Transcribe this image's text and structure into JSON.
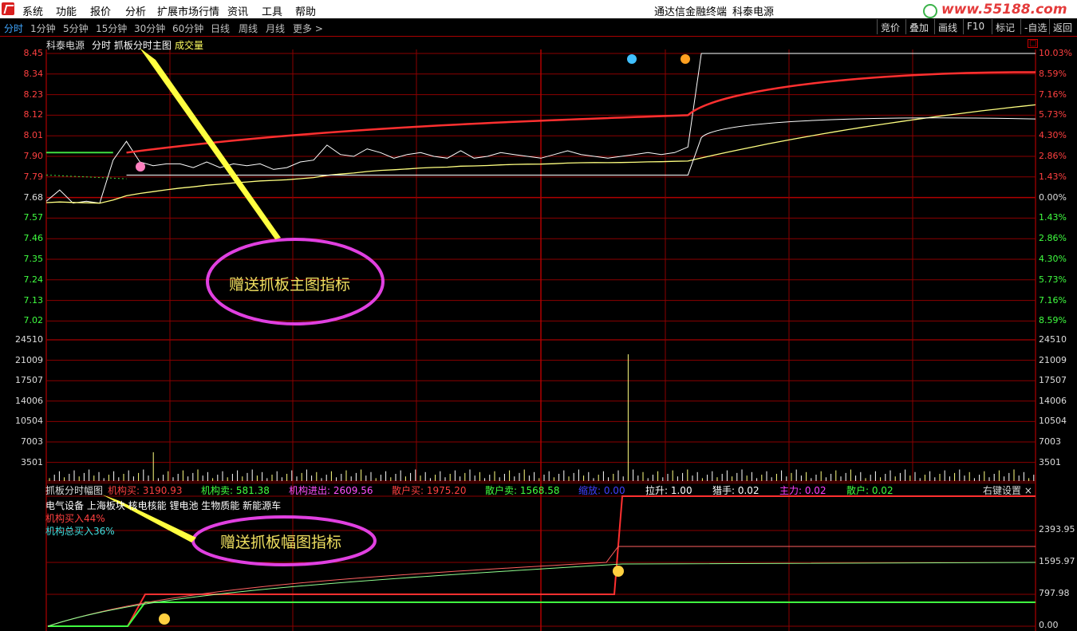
{
  "menu": {
    "items": [
      "系统",
      "功能",
      "报价",
      "分析",
      "扩展市场行情",
      "资讯",
      "工具",
      "帮助"
    ],
    "title": "通达信金融终端",
    "stock_name": "科泰电源",
    "watermark": "www.55188.com"
  },
  "periods": [
    "分时",
    "1分钟",
    "5分钟",
    "15分钟",
    "30分钟",
    "60分钟",
    "日线",
    "周线",
    "月线",
    "更多 >"
  ],
  "right_buttons": [
    "竞价",
    "叠加",
    "画线",
    "F10",
    "标记",
    "-自选",
    "返回"
  ],
  "main_legend": {
    "stock": "科泰电源",
    "label": "分时 抓板分时主图",
    "volume": "成交量"
  },
  "annotations": {
    "main": "赠送抓板主图指标",
    "sub": "赠送抓板幅图指标"
  },
  "price_axis": [
    "8.45",
    "8.34",
    "8.23",
    "8.12",
    "8.01",
    "7.90",
    "7.79",
    "7.68",
    "7.57",
    "7.46",
    "7.35",
    "7.24",
    "7.13",
    "7.02"
  ],
  "pct_axis": [
    "10.03%",
    "8.59%",
    "7.16%",
    "5.73%",
    "4.30%",
    "2.86%",
    "1.43%",
    "0.00%",
    "1.43%",
    "2.86%",
    "4.30%",
    "5.73%",
    "7.16%",
    "8.59%"
  ],
  "vol_axis": [
    "24510",
    "21009",
    "17507",
    "14006",
    "10504",
    "7003",
    "3501"
  ],
  "indicator": {
    "name": "抓板分时幅图",
    "items": [
      {
        "label": "机构买: ",
        "value": "3190.93",
        "color": "#ff4040"
      },
      {
        "label": "机构卖: ",
        "value": "581.38",
        "color": "#40ff40"
      },
      {
        "label": "机构进出: ",
        "value": "2609.56",
        "color": "#ff50ff"
      },
      {
        "label": "散户买: ",
        "value": "1975.20",
        "color": "#ff4040"
      },
      {
        "label": "散户卖: ",
        "value": "1568.58",
        "color": "#40ff40"
      },
      {
        "label": "缩放: ",
        "value": "0.00",
        "color": "#4040ff"
      },
      {
        "label": "拉升: ",
        "value": "1.00",
        "color": "#ffffff"
      },
      {
        "label": "猎手: ",
        "value": "0.02",
        "color": "#ffffff"
      },
      {
        "label": "主力: ",
        "value": "0.02",
        "color": "#ff40ff"
      },
      {
        "label": "散户: ",
        "value": "0.02",
        "color": "#40ff40"
      }
    ],
    "settings": "右键设置 ×",
    "sectors": "电气设备 上海板块 核电核能 锂电池 生物质能 新能源车",
    "inst_buy": "机构买入44%",
    "inst_total": "机构总买入36%"
  },
  "sub_axis": [
    "2393.95",
    "1595.97",
    "797.98",
    "0.00"
  ],
  "colors": {
    "grid": "#8b0000",
    "up": "#ff3030",
    "down": "#40ff40",
    "price": "#ffffff",
    "avg": "#ffff80"
  },
  "chart_data": {
    "type": "line",
    "title": "科泰电源 分时",
    "prev_close": 7.68,
    "price_line": [
      7.66,
      7.72,
      7.65,
      7.66,
      7.65,
      7.88,
      7.98,
      7.87,
      7.85,
      7.86,
      7.86,
      7.84,
      7.87,
      7.84,
      7.86,
      7.85,
      7.86,
      7.83,
      7.84,
      7.87,
      7.88,
      7.96,
      7.91,
      7.9,
      7.94,
      7.92,
      7.89,
      7.91,
      7.92,
      7.9,
      7.89,
      7.93,
      7.89,
      7.9,
      7.92,
      7.91,
      7.9,
      7.89,
      7.91,
      7.93,
      7.91,
      7.9,
      7.89,
      7.9,
      7.91,
      7.92,
      7.91,
      7.92,
      7.95,
      8.45,
      8.45,
      8.45,
      8.45,
      8.45,
      8.45,
      8.45,
      8.45,
      8.45,
      8.45,
      8.45,
      8.45,
      8.45,
      8.45,
      8.45,
      8.45,
      8.45,
      8.45,
      8.45,
      8.45,
      8.45,
      8.45,
      8.45,
      8.45,
      8.45,
      8.45
    ],
    "volume_peaks": [
      {
        "x": "13:05",
        "value": 22000
      }
    ],
    "ylim": [
      7.02,
      8.45
    ]
  }
}
